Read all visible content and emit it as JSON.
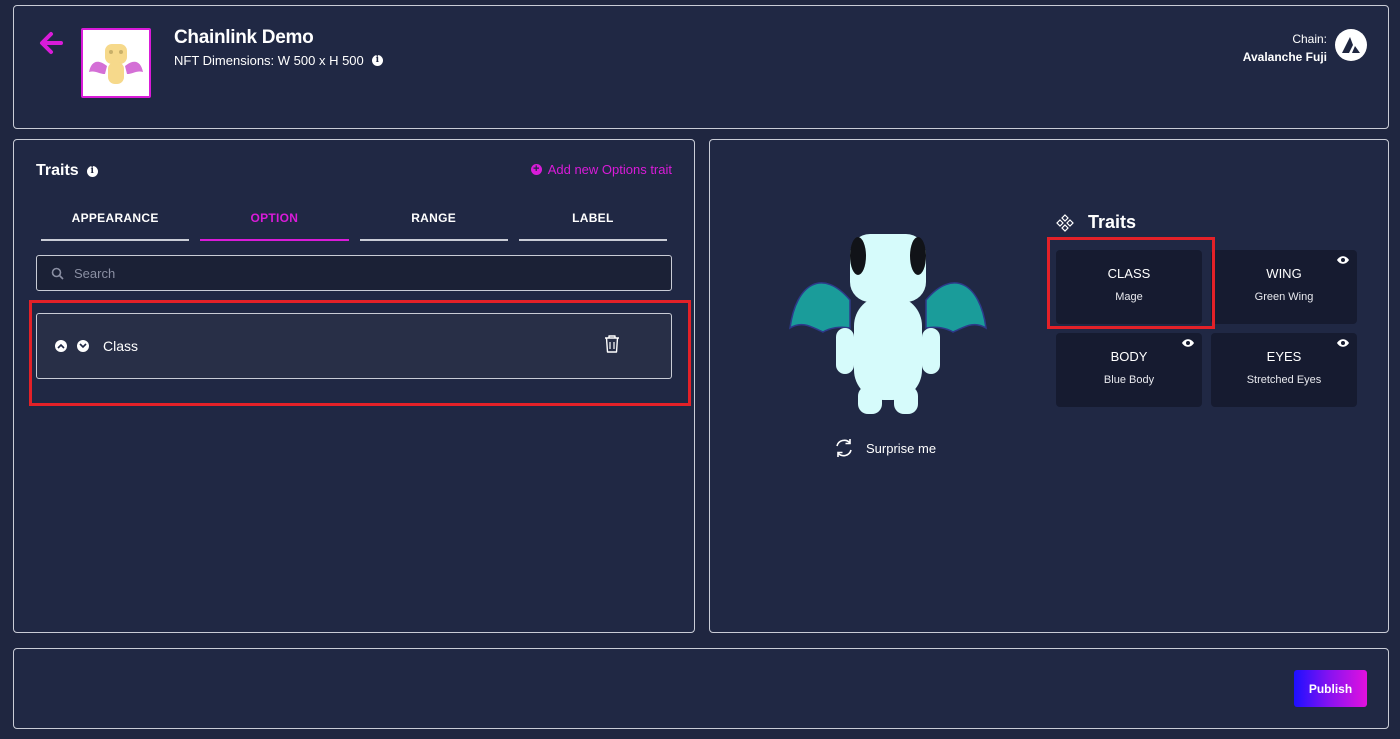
{
  "header": {
    "title": "Chainlink Demo",
    "dimensions": "NFT Dimensions: W 500 x H 500",
    "chain_label": "Chain:",
    "chain_value": "Avalanche Fuji"
  },
  "traits_panel": {
    "heading": "Traits",
    "add_link": "Add new Options trait",
    "tabs": [
      "APPEARANCE",
      "OPTION",
      "RANGE",
      "LABEL"
    ],
    "active_tab": "OPTION",
    "search_placeholder": "Search",
    "option_row": {
      "label": "Class"
    }
  },
  "preview": {
    "surprise_label": "Surprise me",
    "traits_title": "Traits",
    "cards": [
      {
        "name": "CLASS",
        "value": "Mage"
      },
      {
        "name": "WING",
        "value": "Green Wing"
      },
      {
        "name": "BODY",
        "value": "Blue Body"
      },
      {
        "name": "EYES",
        "value": "Stretched Eyes"
      }
    ]
  },
  "footer": {
    "publish_label": "Publish"
  },
  "colors": {
    "background": "#1f2640",
    "accent": "#d91bd9",
    "highlight": "#e32128",
    "card": "#161b30"
  },
  "icons": [
    "arrow-left-icon",
    "info-icon",
    "avalanche-logo-icon",
    "plus-circle-icon",
    "search-icon",
    "chevron-up-icon",
    "chevron-down-icon",
    "trash-icon",
    "refresh-icon",
    "traits-diamond-icon",
    "eye-icon"
  ]
}
